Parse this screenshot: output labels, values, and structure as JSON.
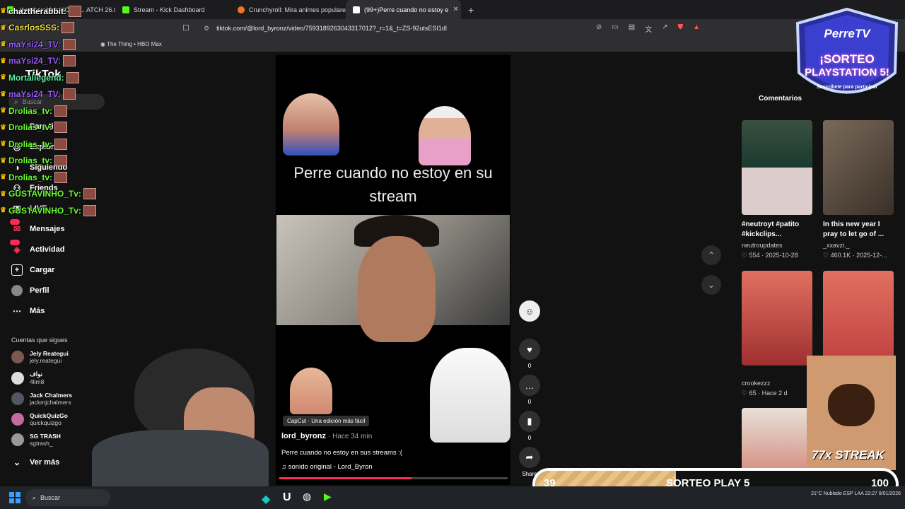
{
  "tabs": [
    {
      "label": "chaztherabbit: HOTS ... ATCH 26.0",
      "color": "#53fc18"
    },
    {
      "label": "Stream - Kick Dashboard",
      "color": "#53fc18"
    },
    {
      "label": "Crunchyroll: Mira animes populares,",
      "color": "#f47521"
    },
    {
      "label": "(99+)Perre cuando no estoy e",
      "color": "#fe2c55"
    }
  ],
  "address": {
    "url": "tiktok.com/@lord_byronz/video/7593189263043317012?_r=1&_t=ZS-92utsESI1dl"
  },
  "bookmarks": [
    "",
    "The Thing • HBO Max"
  ],
  "chat": [
    {
      "user": "chaztherabbit:",
      "color": "#ffffff"
    },
    {
      "user": "CasrlosSSS:",
      "color": "#f0e040"
    },
    {
      "user": "maYsi24_TV:",
      "color": "#9b5cff"
    },
    {
      "user": "maYsi24_TV:",
      "color": "#9b5cff"
    },
    {
      "user": "Mortallegend:",
      "color": "#5ef0a0"
    },
    {
      "user": "maYsi24_TV:",
      "color": "#9b5cff"
    },
    {
      "user": "Drolias_tv:",
      "color": "#6aff30"
    },
    {
      "user": "Drolias_tv:",
      "color": "#6aff30"
    },
    {
      "user": "Drolias_tv:",
      "color": "#6aff30"
    },
    {
      "user": "Drolias_tv:",
      "color": "#6aff30"
    },
    {
      "user": "Drolias_tv:",
      "color": "#6aff30"
    },
    {
      "user": "GUSTAVINHO_Tv:",
      "color": "#6aff30"
    },
    {
      "user": "GUSTAVINHO_Tv:",
      "color": "#6aff30"
    }
  ],
  "sidebar": {
    "logo": "TikTok",
    "search_placeholder": "Buscar",
    "nav": [
      "Para ti",
      "Explorar",
      "Siguiendo",
      "Friends",
      "LIVE",
      "Mensajes",
      "Actividad",
      "Cargar",
      "Perfil",
      "Más"
    ],
    "badge": "99+",
    "following_title": "Cuentas que sigues",
    "following": [
      {
        "name": "Jely Reategui",
        "handle": "jely.reategui"
      },
      {
        "name": "نواف",
        "handle": "4lim8"
      },
      {
        "name": "Jack Chalmers",
        "handle": "jackmjchalmers"
      },
      {
        "name": "QuickQuizGo",
        "handle": "quickquizgo"
      },
      {
        "name": "SG TRASH",
        "handle": "sgtrash_"
      }
    ],
    "see_more": "Ver más"
  },
  "video": {
    "title": "Perre cuando no estoy en su stream",
    "capcut": "CapCut · Una edición más fácil",
    "author": "lord_byronz",
    "time": "· Hace 34 min",
    "description": "Perre cuando no estoy en sus streams :(",
    "sound": "sonido original - Lord_Byron",
    "progress": 0.58,
    "likes": "0",
    "comments": "0",
    "saves": "0",
    "share": "Share"
  },
  "right": {
    "comments_tab": "Comentarios",
    "items": [
      {
        "caption": "#neutroyt #patito #kickclips...",
        "user": "neutroupdates",
        "stats": "554 · 2025-10-28"
      },
      {
        "caption": "In this new year I pray to let go of ...",
        "user": "_xxavzi._",
        "stats": "460.1K · 2025-12-..."
      },
      {
        "caption": "",
        "user": "crookezzz",
        "stats": "65 · Hace 2 d"
      }
    ]
  },
  "overlay": {
    "brand": "PerreTV",
    "promo1": "¡SORTEO",
    "promo2": "PLAYSTATION 5!",
    "promo3": "Suscríbete para participar",
    "streak": "77x STREAK"
  },
  "sorteo": {
    "current": "39",
    "label": "SORTEO PLAY 5",
    "goal": "100",
    "fraction": 0.39
  },
  "taskbar": {
    "search": "Buscar",
    "temp": "21°C",
    "weather": "Nublado",
    "lang": "ESP",
    "lang2": "LAA",
    "time": "22:27",
    "date": "8/01/2026"
  }
}
